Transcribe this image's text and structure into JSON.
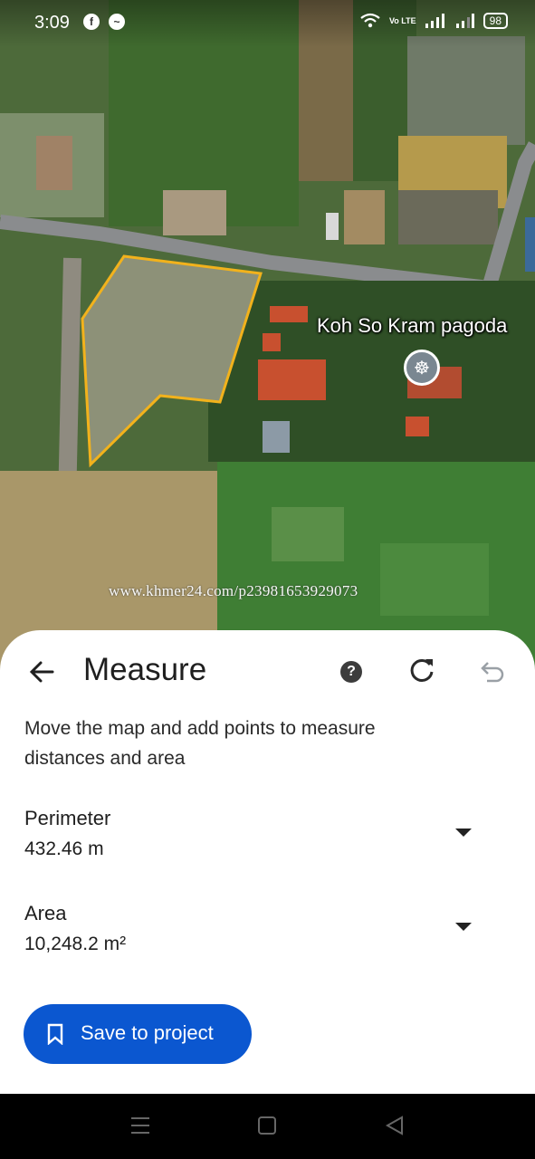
{
  "status_bar": {
    "time": "3:09",
    "app_icons": [
      "facebook-icon",
      "messenger-icon"
    ],
    "network": "Vo LTE",
    "battery": "98"
  },
  "map": {
    "place_label": "Koh So Kram pagoda",
    "place_icon": "pagoda-icon",
    "watermark": "www.khmer24.com/p23981653929073",
    "polygon_color": "#f2b21c"
  },
  "sheet": {
    "title": "Measure",
    "instructions": "Move the map and add points to measure distances and area",
    "perimeter": {
      "label": "Perimeter",
      "value": "432.46 m"
    },
    "area": {
      "label": "Area",
      "value": "10,248.2 m²"
    },
    "save_label": "Save to project",
    "accent_color": "#0b57d0"
  },
  "nav": {
    "buttons": [
      "menu-icon",
      "home-icon",
      "back-triangle-icon"
    ]
  }
}
